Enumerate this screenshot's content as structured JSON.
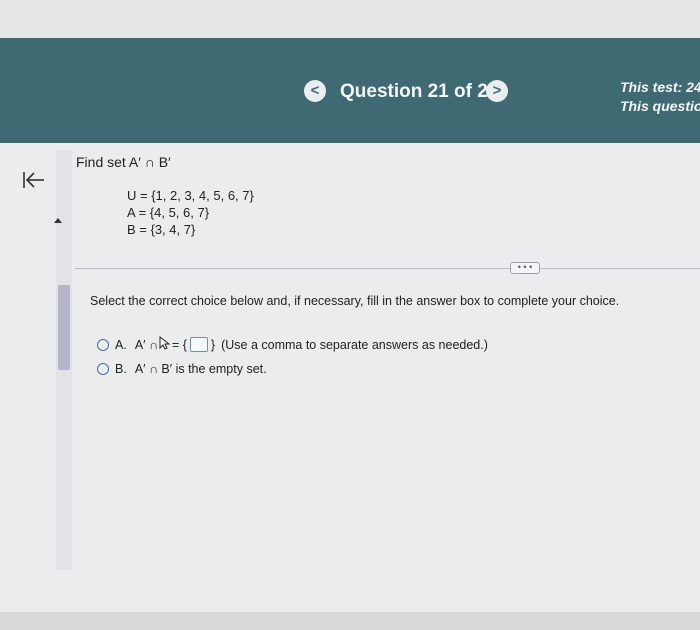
{
  "header": {
    "title": "Question 21 of 24",
    "prev_label": "<",
    "next_label": ">",
    "test_info": "This test: 24",
    "question_info": "This questio"
  },
  "question": {
    "prompt": "Find set A′ ∩ B′",
    "sets": [
      "U = {1, 2, 3, 4, 5, 6, 7}",
      "A = {4, 5, 6, 7}",
      "B = {3, 4, 7}"
    ]
  },
  "more_label": "• • •",
  "instructions": "Select the correct choice below and, if necessary, fill in the answer box to complete your choice.",
  "choices": {
    "a": {
      "letter": "A.",
      "pre": "A′ ∩ ",
      "eq": "= {",
      "close": "}",
      "hint": "(Use a comma to separate answers as needed.)"
    },
    "b": {
      "letter": "B.",
      "text": "A′ ∩ B′ is the empty set."
    }
  },
  "colors": {
    "header_bg": "#3f6a74",
    "radio": "#4a6fa5",
    "scroll_thumb": "#b2b6c7"
  }
}
